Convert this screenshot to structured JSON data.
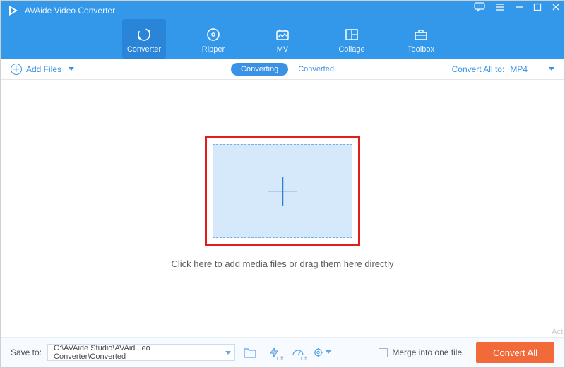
{
  "app": {
    "title": "AVAide Video Converter"
  },
  "nav": {
    "items": [
      {
        "label": "Converter"
      },
      {
        "label": "Ripper"
      },
      {
        "label": "MV"
      },
      {
        "label": "Collage"
      },
      {
        "label": "Toolbox"
      }
    ]
  },
  "toolbar": {
    "add_files_label": "Add Files",
    "converting_label": "Converting",
    "converted_label": "Converted",
    "convert_all_to_label": "Convert All to:",
    "convert_all_to_value": "MP4"
  },
  "main": {
    "hint": "Click here to add media files or drag them here directly"
  },
  "footer": {
    "save_to_label": "Save to:",
    "save_to_path": "C:\\AVAide Studio\\AVAid...eo Converter\\Converted",
    "merge_label": "Merge into one file",
    "convert_all_button": "Convert All"
  },
  "watermark": "Act"
}
